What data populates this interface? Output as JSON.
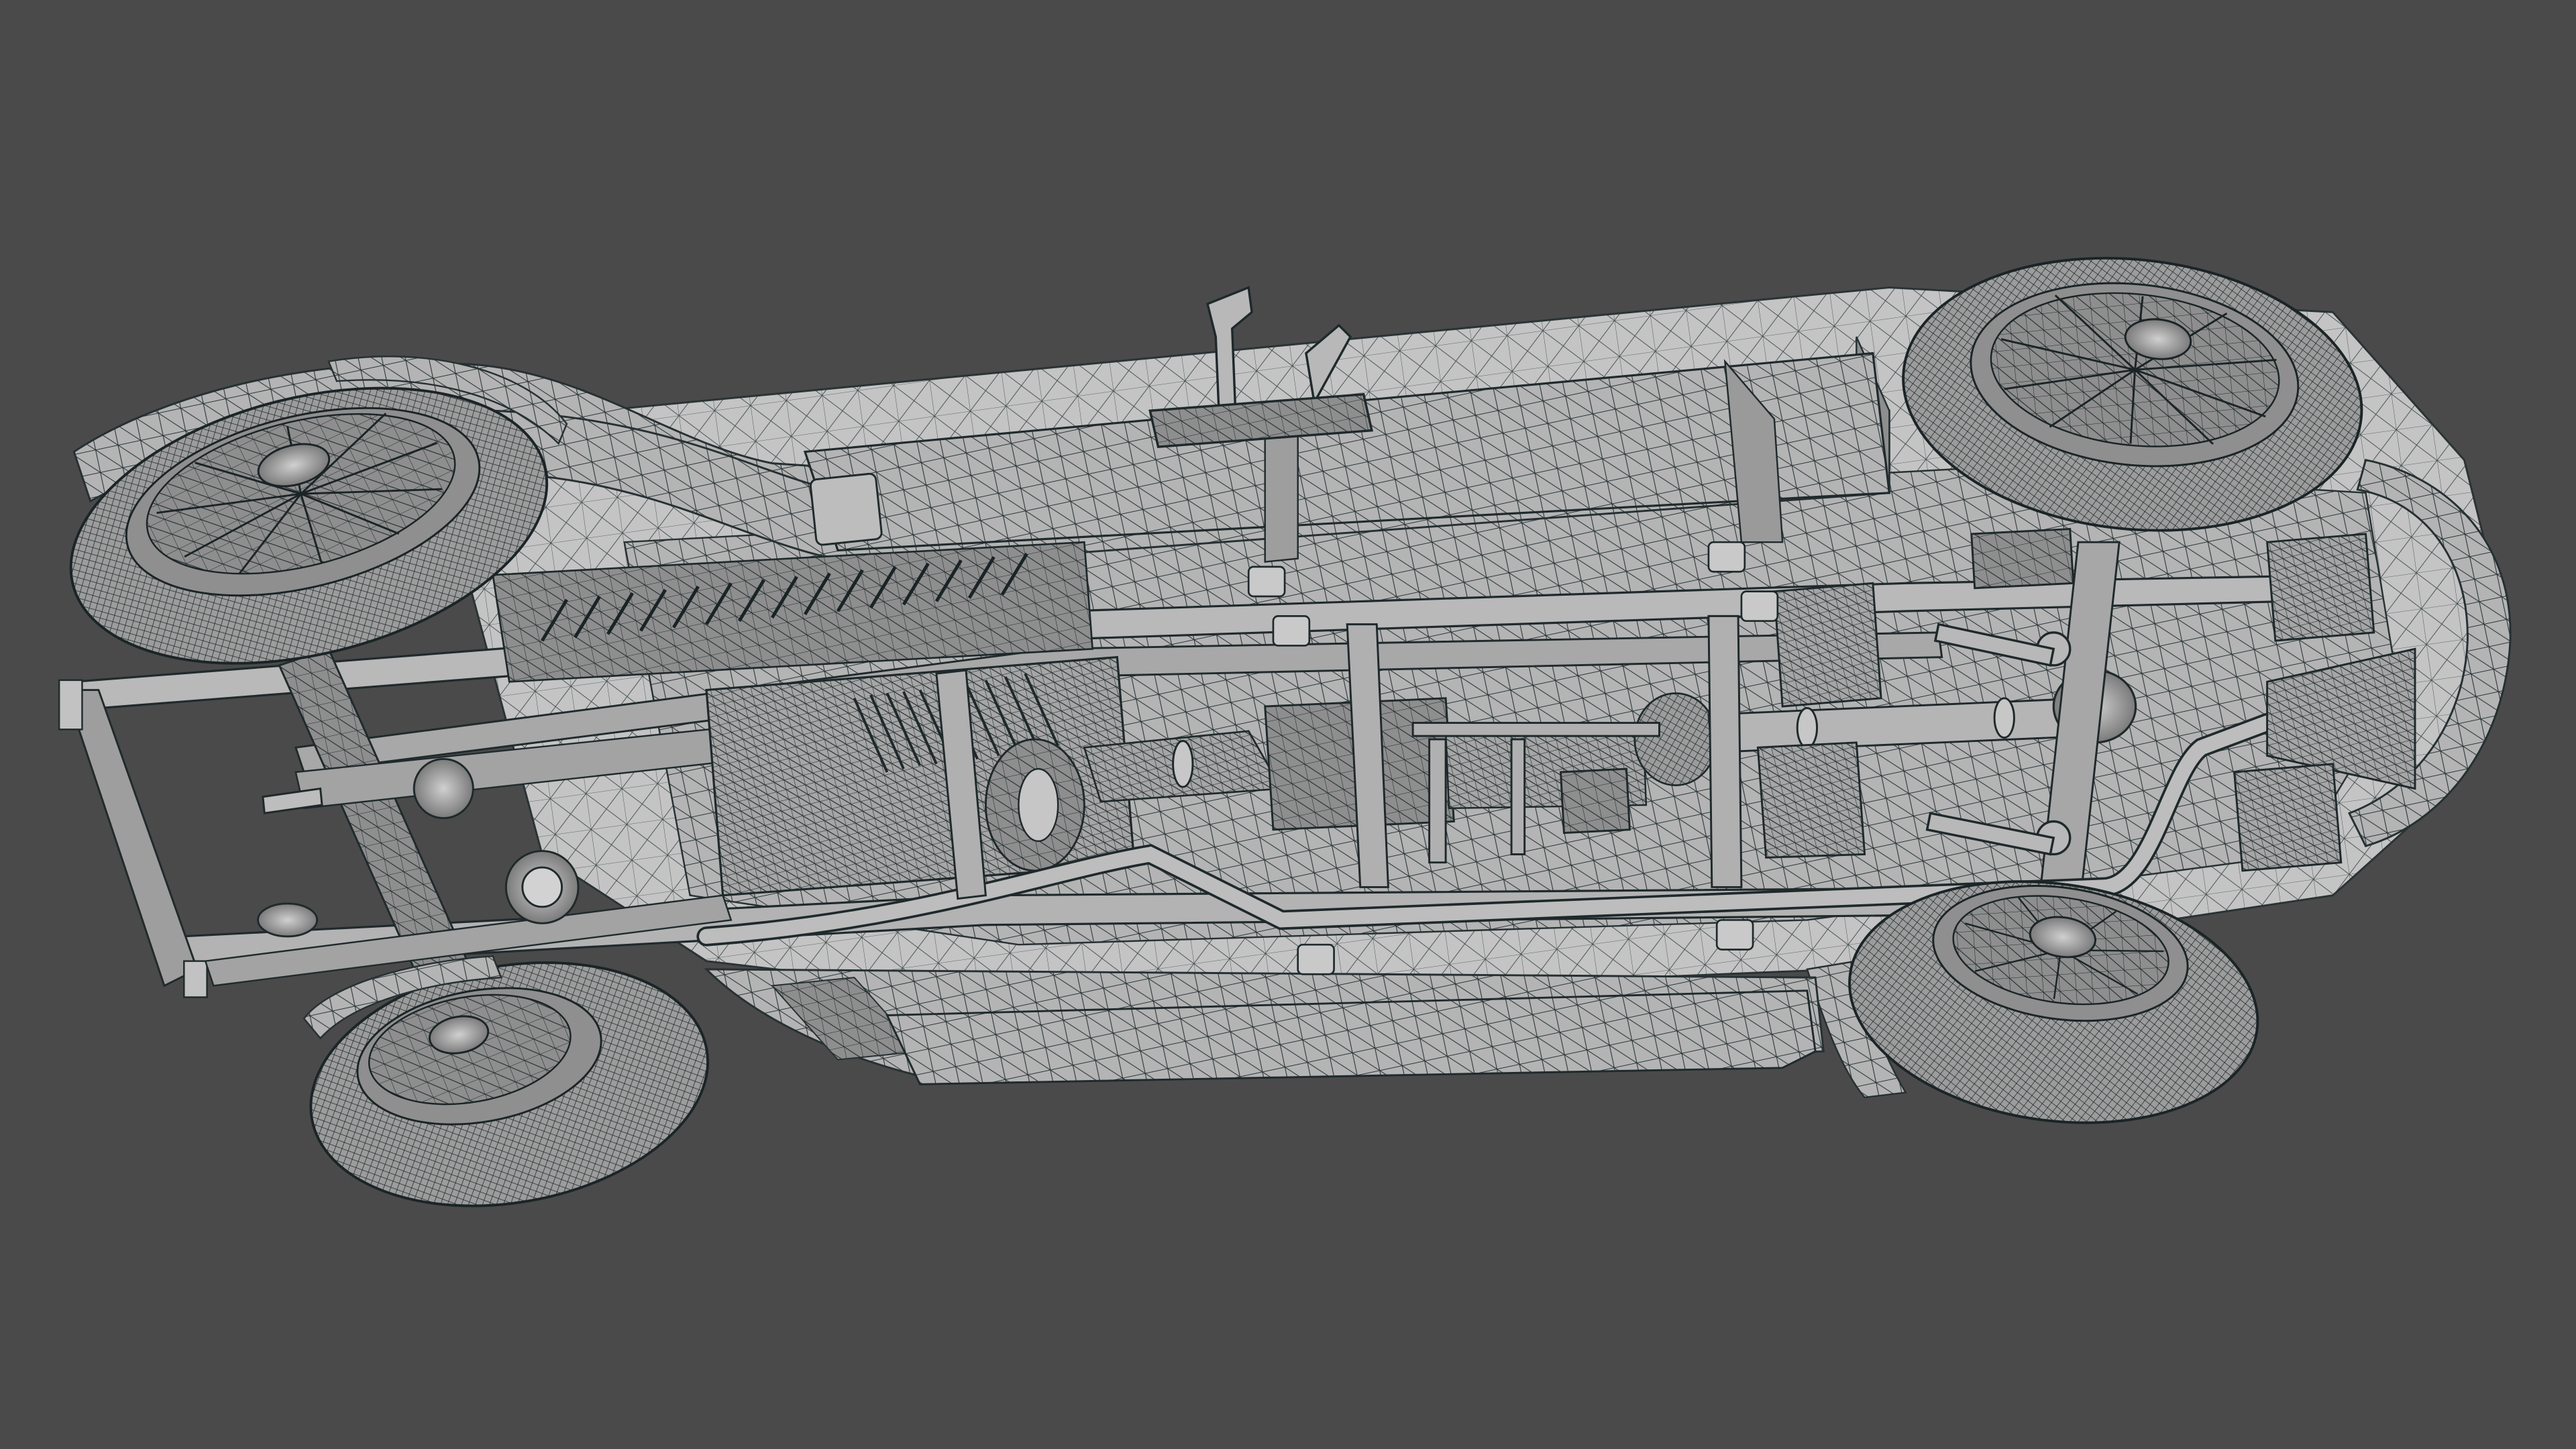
{
  "viewport": {
    "background_color": "#4a4a4a",
    "subject": "car-chassis-underside-wireframe",
    "render_style": "wireframe-over-gray-shaded",
    "wire_color": "#1f2a2e",
    "surface_color": "#a9a9a9",
    "surface_light_color": "#c8c8c8",
    "surface_dark_color": "#7d7d7d"
  }
}
